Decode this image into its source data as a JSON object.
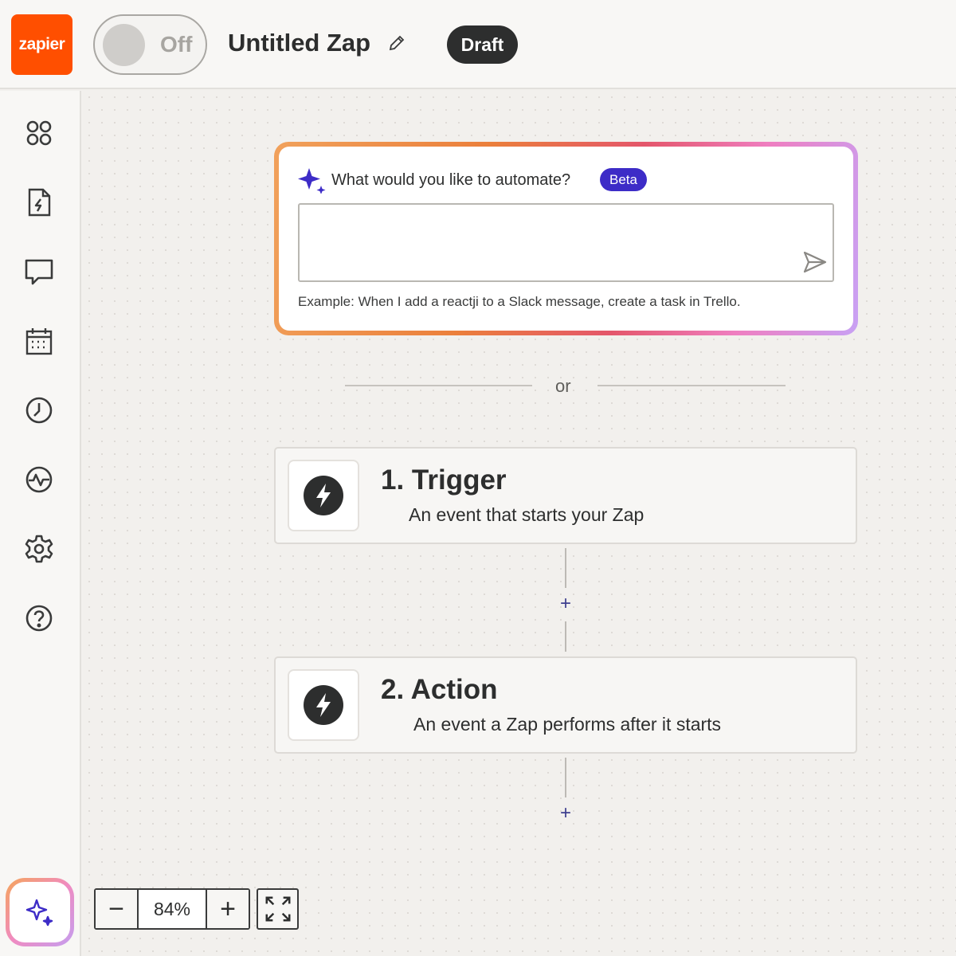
{
  "header": {
    "logo_text": "zapier",
    "toggle_label": "Off",
    "zap_title": "Untitled Zap",
    "status_badge": "Draft"
  },
  "sidebar": {
    "items": [
      {
        "icon": "apps-icon"
      },
      {
        "icon": "zap-file-icon"
      },
      {
        "icon": "comment-icon"
      },
      {
        "icon": "calendar-icon"
      },
      {
        "icon": "history-clock-icon"
      },
      {
        "icon": "activity-icon"
      },
      {
        "icon": "settings-gear-icon"
      },
      {
        "icon": "help-icon"
      }
    ],
    "ai_button_icon": "sparkle-icon"
  },
  "ai_prompt": {
    "question": "What would you like to automate?",
    "badge": "Beta",
    "input_value": "",
    "example": "Example: When I add a reactji to a Slack message, create a task in Trello."
  },
  "divider_text": "or",
  "steps": [
    {
      "title": "1. Trigger",
      "subtitle": "An event that starts your Zap",
      "icon": "bolt-icon"
    },
    {
      "title": "2. Action",
      "subtitle": "An event a Zap performs after it starts",
      "icon": "bolt-icon"
    }
  ],
  "add_step_symbol": "+",
  "zoom": {
    "minus": "−",
    "value": "84%",
    "plus": "+"
  },
  "colors": {
    "brand": "#ff4f00",
    "beta_badge": "#3d2cc7",
    "draft_badge": "#2d2e2e"
  }
}
